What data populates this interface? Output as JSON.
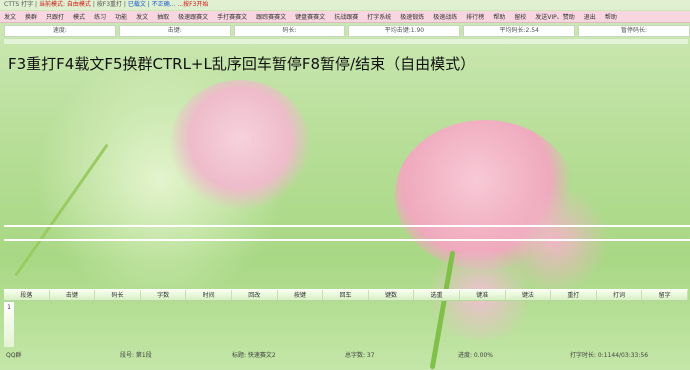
{
  "window": {
    "title_prefix": "CTTS 打字 | ",
    "title_highlight": "当前模式: 自由模式",
    "title_mid": " | 按F3重打 | ",
    "title_highlight2": "已载文 | 不正确...",
    "title_suffix": "...按F3开始"
  },
  "menu": {
    "items": [
      "发文",
      "换群",
      "只跟打",
      "模式",
      "练习",
      "功能",
      "发文",
      "抽取",
      "极速跟赛文",
      "手打赛赛文",
      "跟踪赛赛文",
      "键盘赛赛文",
      "抗战跟赛",
      "打字系统",
      "极速锻炼",
      "极速战练",
      "排行榜",
      "帮助",
      "留校",
      "发送VIP、赞助",
      "退出",
      "帮助"
    ]
  },
  "stats": {
    "items": [
      "速度:",
      "击键:",
      "码长:",
      "平均击键:1.90",
      "平均码长:2.54",
      "暂停码长:"
    ]
  },
  "progress": {
    "fraction": 0.0
  },
  "hint": {
    "text": "F3重打F4载文F5换群CTRL+L乱序回车暂停F8暂停/结束（自由模式）"
  },
  "table": {
    "headers": [
      "段落",
      "击键",
      "码长",
      "字数",
      "时间",
      "回改",
      "按键",
      "回车",
      "键数",
      "选重",
      "键准",
      "键法",
      "重打",
      "打词",
      "留字"
    ],
    "row_number": "1"
  },
  "status": {
    "mode": "QQ群",
    "segment": "段号: 第1段",
    "source": "标题: 快速赛文2",
    "total_chars": "总字数: 37",
    "progress_pct": "进度: 0.00%",
    "time": "打字时长: 0:1144/03:33:56"
  },
  "colors": {
    "menu_bg": "#f7d6df",
    "bg_green": "#b9df9a",
    "flower_pink": "#efa9bd",
    "title_red": "#d01818"
  }
}
